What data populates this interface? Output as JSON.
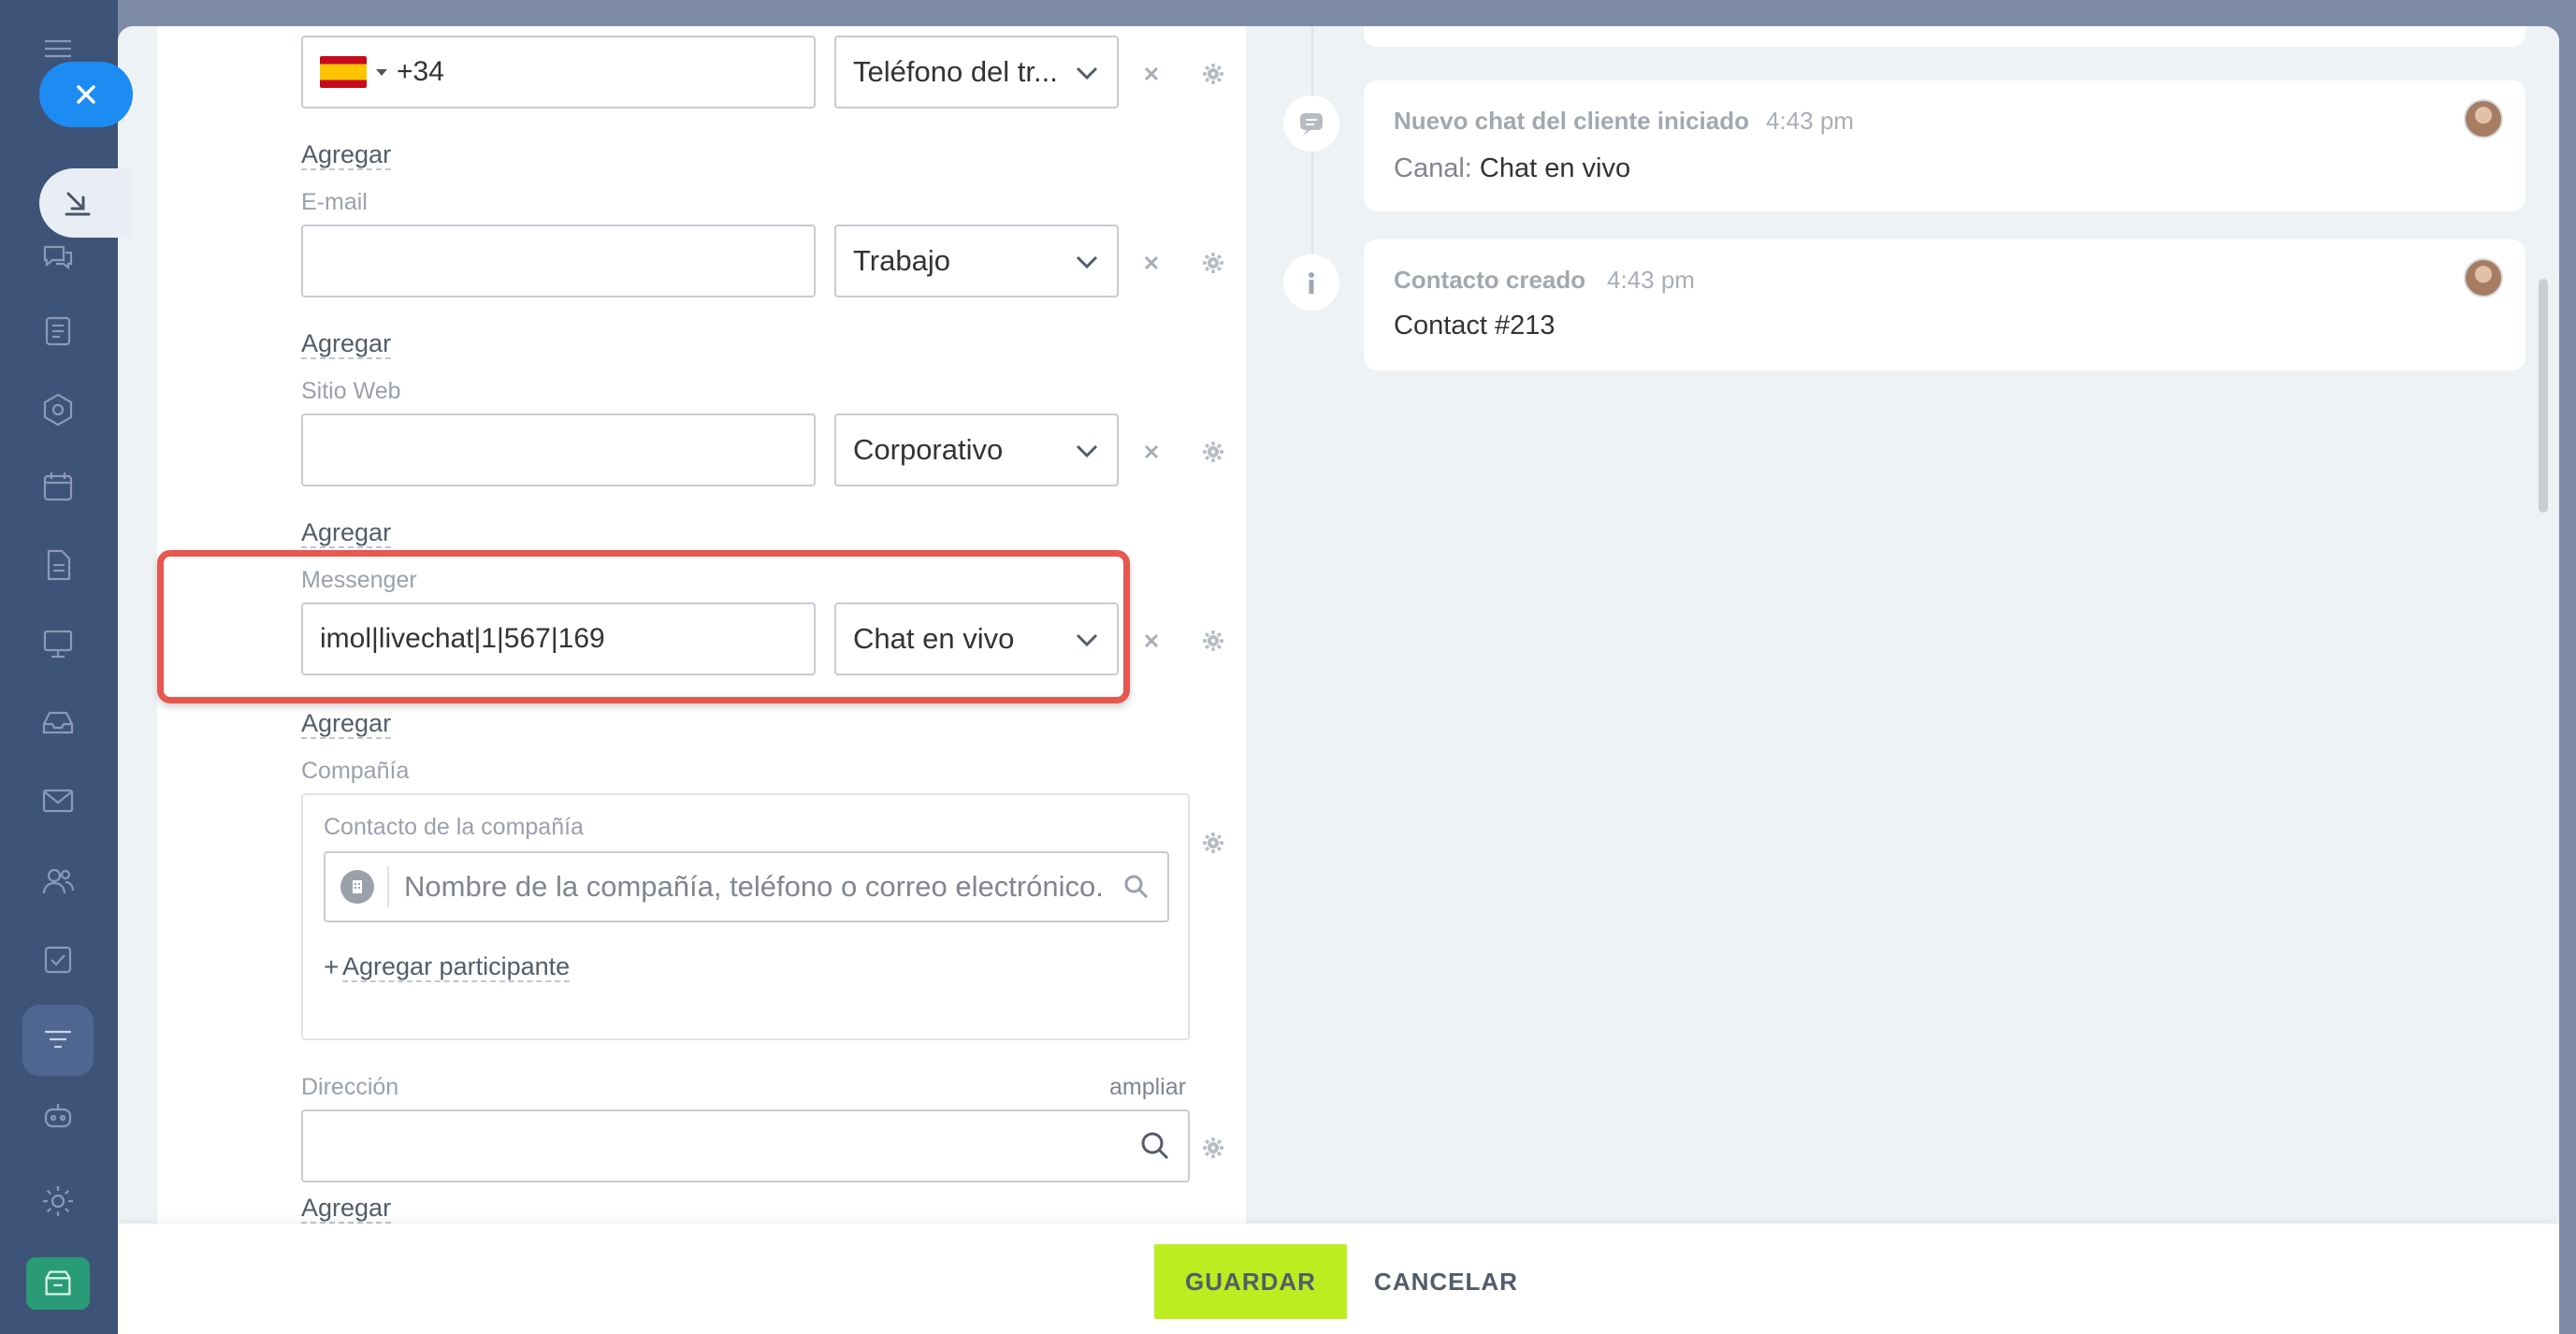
{
  "form": {
    "phone": {
      "country_flag": "spain-flag-icon",
      "value": "+34",
      "type": "Teléfono del tr...",
      "add_label": "Agregar"
    },
    "email": {
      "label": "E-mail",
      "value": "",
      "type": "Trabajo",
      "add_label": "Agregar"
    },
    "website": {
      "label": "Sitio Web",
      "value": "",
      "type": "Corporativo",
      "add_label": "Agregar"
    },
    "messenger": {
      "label": "Messenger",
      "value": "imol|livechat|1|567|169",
      "type": "Chat en vivo",
      "add_label": "Agregar"
    },
    "company": {
      "label": "Compañía",
      "inner_label": "Contacto de la compañía",
      "search_placeholder": "Nombre de la compañía, teléfono o correo electrónico.",
      "add_participant": "Agregar participante",
      "add_prefix": "+"
    },
    "address": {
      "label": "Dirección",
      "expand": "ampliar",
      "value": "",
      "add_label": "Agregar"
    }
  },
  "timeline": {
    "items": [
      {
        "title": "Nuevo chat del cliente iniciado",
        "time": "4:43 pm",
        "body_label": "Canal:",
        "body_value": "Chat en vivo",
        "icon": "chat-icon"
      },
      {
        "title": "Contacto creado",
        "time": "4:43 pm",
        "body_label": "",
        "body_value": "Contact #213",
        "icon": "info-icon"
      }
    ]
  },
  "footer": {
    "save_label": "GUARDAR",
    "cancel_label": "CANCELAR"
  },
  "colors": {
    "sidebar": "#3d5378",
    "accent_save": "#bbed21",
    "highlight": "#e8574f",
    "close_button": "#1d8cf2"
  }
}
